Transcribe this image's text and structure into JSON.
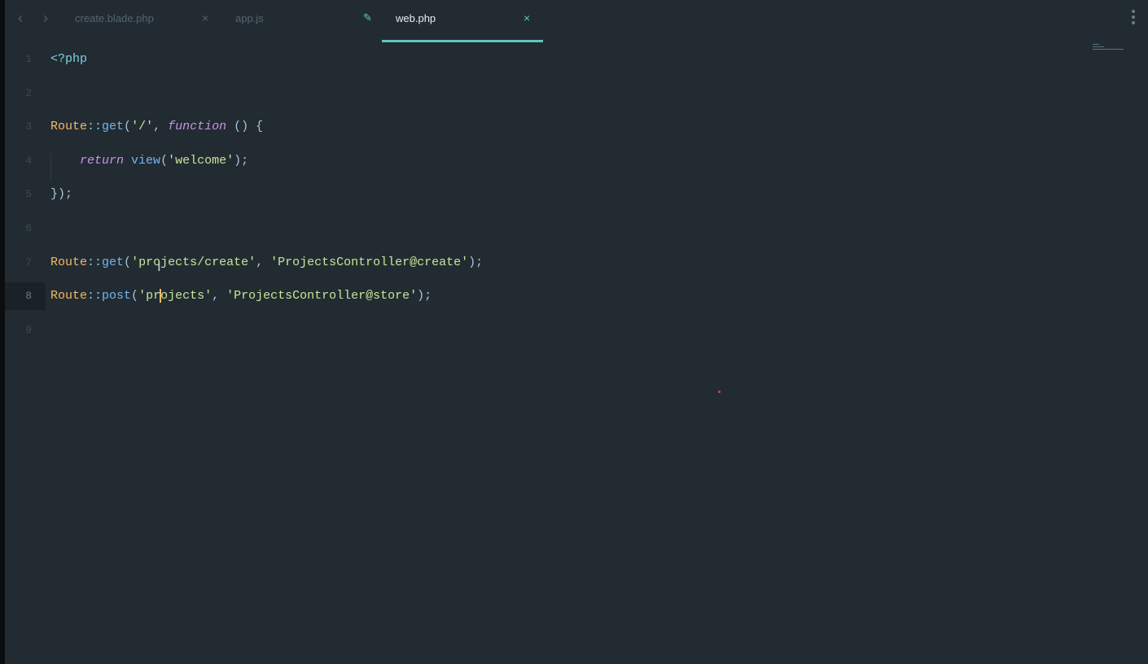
{
  "tabs": [
    {
      "label": "create.blade.php",
      "close": "×",
      "active": false
    },
    {
      "label": "app.js",
      "close": "",
      "active": false
    },
    {
      "label": "web.php",
      "close": "×",
      "active": true
    }
  ],
  "nav": {
    "back": "‹",
    "forward": "›"
  },
  "icons": {
    "pencil": "✎"
  },
  "cursor_line": 8,
  "lines": [
    {
      "n": "1",
      "tokens": [
        [
          "<?php",
          "tag"
        ]
      ]
    },
    {
      "n": "2",
      "tokens": []
    },
    {
      "n": "3",
      "tokens": [
        [
          "Route",
          "cls"
        ],
        [
          "::",
          "op"
        ],
        [
          "get",
          "fn"
        ],
        [
          "(",
          "p"
        ],
        [
          "'/'",
          "str"
        ],
        [
          ", ",
          "p"
        ],
        [
          "function",
          "kw"
        ],
        [
          " () {",
          "p"
        ]
      ]
    },
    {
      "n": "4",
      "tokens": [
        [
          "    ",
          "p"
        ],
        [
          "return",
          "kw"
        ],
        [
          " ",
          "p"
        ],
        [
          "view",
          "fn"
        ],
        [
          "(",
          "p"
        ],
        [
          "'welcome'",
          "str"
        ],
        [
          ");",
          "p"
        ]
      ]
    },
    {
      "n": "5",
      "tokens": [
        [
          "});",
          "p"
        ]
      ]
    },
    {
      "n": "6",
      "tokens": []
    },
    {
      "n": "7",
      "tokens": [
        [
          "Route",
          "cls"
        ],
        [
          "::",
          "op"
        ],
        [
          "get",
          "fn"
        ],
        [
          "(",
          "p"
        ],
        [
          "'projects/create'",
          "str"
        ],
        [
          ", ",
          "p"
        ],
        [
          "'ProjectsController@create'",
          "str"
        ],
        [
          ");",
          "p"
        ]
      ]
    },
    {
      "n": "8",
      "tokens": [
        [
          "Route",
          "cls"
        ],
        [
          "::",
          "op"
        ],
        [
          "post",
          "fn"
        ],
        [
          "(",
          "p"
        ],
        [
          "'pr",
          "str"
        ],
        [
          "|caret",
          "caret"
        ],
        [
          "ojects'",
          "str"
        ],
        [
          ", ",
          "p"
        ],
        [
          "'ProjectsController@store'",
          "str"
        ],
        [
          ");",
          "p"
        ]
      ]
    },
    {
      "n": "9",
      "tokens": []
    }
  ]
}
